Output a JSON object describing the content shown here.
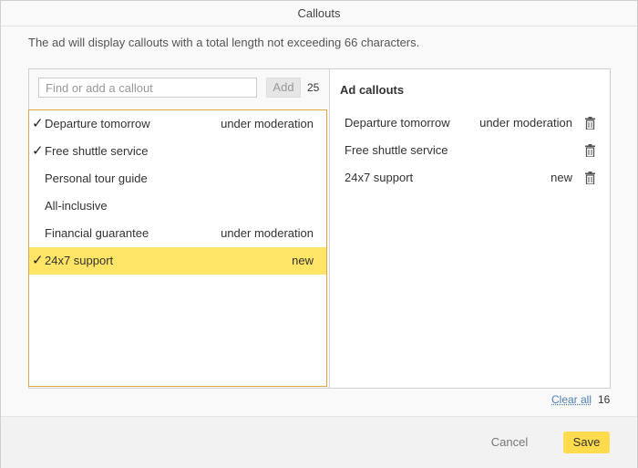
{
  "dialog": {
    "title": "Callouts",
    "note": "The ad will display callouts with a total length not exceeding 66 characters."
  },
  "search": {
    "placeholder": "Find or add a callout",
    "value": "",
    "add_label": "Add",
    "count": "25"
  },
  "list": [
    {
      "label": "Departure tomorrow",
      "status": "under moderation",
      "checked": true,
      "selected": false
    },
    {
      "label": "Free shuttle service",
      "status": "",
      "checked": true,
      "selected": false
    },
    {
      "label": "Personal tour guide",
      "status": "",
      "checked": false,
      "selected": false
    },
    {
      "label": "All-inclusive",
      "status": "",
      "checked": false,
      "selected": false
    },
    {
      "label": "Financial guarantee",
      "status": "under moderation",
      "checked": false,
      "selected": false
    },
    {
      "label": "24x7 support",
      "status": "new",
      "checked": true,
      "selected": true
    }
  ],
  "ad_callouts": {
    "header": "Ad callouts",
    "items": [
      {
        "label": "Departure tomorrow",
        "status": "under moderation"
      },
      {
        "label": "Free shuttle service",
        "status": ""
      },
      {
        "label": "24x7 support",
        "status": "new"
      }
    ]
  },
  "summary": {
    "clear_all_label": "Clear all",
    "count": "16"
  },
  "footer": {
    "cancel_label": "Cancel",
    "save_label": "Save"
  },
  "icons": {
    "check": "check-icon",
    "trash": "trash-icon"
  },
  "colors": {
    "accent": "#ffdb4d",
    "selected_row": "#ffe566",
    "focus_border": "#e0a83a",
    "link": "#4a7fb5"
  }
}
